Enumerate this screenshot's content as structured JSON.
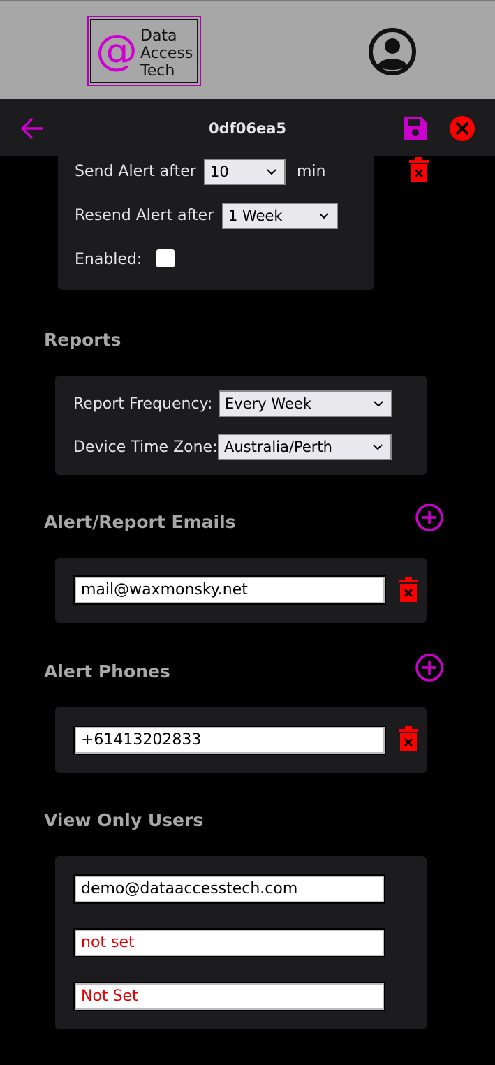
{
  "brand": {
    "logo_symbol": "@",
    "logo_line1": "Data",
    "logo_line2": "Access",
    "logo_line3": "Tech",
    "accent_color": "#cc00cc",
    "danger_color": "#ff0000"
  },
  "titlebar": {
    "title": "0df06ea5"
  },
  "alert": {
    "send_label": "Send Alert after",
    "send_value": "10",
    "send_unit": "min",
    "resend_label": "Resend Alert after",
    "resend_value": "1 Week",
    "enabled_label": "Enabled:"
  },
  "reports": {
    "section_title": "Reports",
    "frequency_label": "Report Frequency:",
    "frequency_value": "Every Week",
    "timezone_label": "Device Time Zone:",
    "timezone_value": "Australia/Perth"
  },
  "emails": {
    "section_title": "Alert/Report Emails",
    "items": [
      "mail@waxmonsky.net"
    ]
  },
  "phones": {
    "section_title": "Alert Phones",
    "items": [
      "+61413202833"
    ]
  },
  "view_only": {
    "section_title": "View Only Users",
    "items": [
      "demo@dataaccesstech.com",
      "not set",
      "Not Set"
    ]
  }
}
